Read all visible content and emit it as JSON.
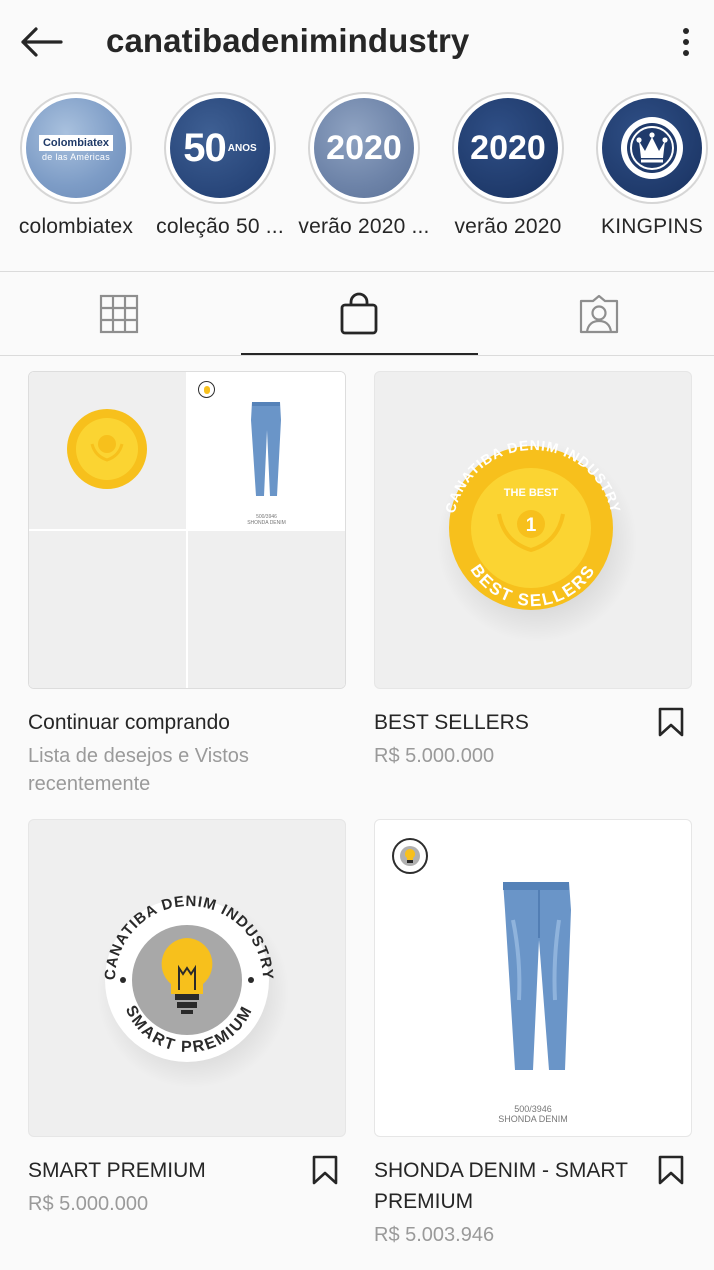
{
  "header": {
    "title": "canatibadenimindustry"
  },
  "highlights": [
    {
      "label": "colombiatex",
      "box_text": "Colombiatex",
      "sub_text": "de las Américas"
    },
    {
      "label": "coleção 50 ...",
      "big": "50",
      "small": "ANOS"
    },
    {
      "label": "verão 2020 ...",
      "big": "2020"
    },
    {
      "label": "verão 2020",
      "big": "2020"
    },
    {
      "label": "KINGPINS"
    }
  ],
  "tabs": [
    "grid-tab",
    "shop-tab",
    "tagged-tab"
  ],
  "products": [
    {
      "name": "Continuar comprando",
      "subtitle": "Lista de desejos e Vistos recentemente"
    },
    {
      "name": "BEST SELLERS",
      "price": "R$ 5.000.000"
    },
    {
      "name": "SMART PREMIUM",
      "price": "R$ 5.000.000"
    },
    {
      "name": "SHONDA DENIM - SMART PREMIUM",
      "price": "R$ 5.003.946"
    }
  ],
  "badges": {
    "best_top": "CANATIBA DENIM INDUSTRY",
    "best_mid": "THE BEST",
    "best_num": "1",
    "best_bottom": "BEST SELLERS",
    "smart_top": "CANATIBA DENIM INDUSTRY",
    "smart_bottom": "SMART PREMIUM",
    "jeans_code": "500/3946",
    "jeans_name": "SHONDA DENIM"
  },
  "colors": {
    "text": "#262626",
    "secondary": "#9a9a9a",
    "badge_yellow": "#f7c01c",
    "badge_yellow_inner": "#fbd432",
    "denim_blue": "#6a95c8"
  }
}
